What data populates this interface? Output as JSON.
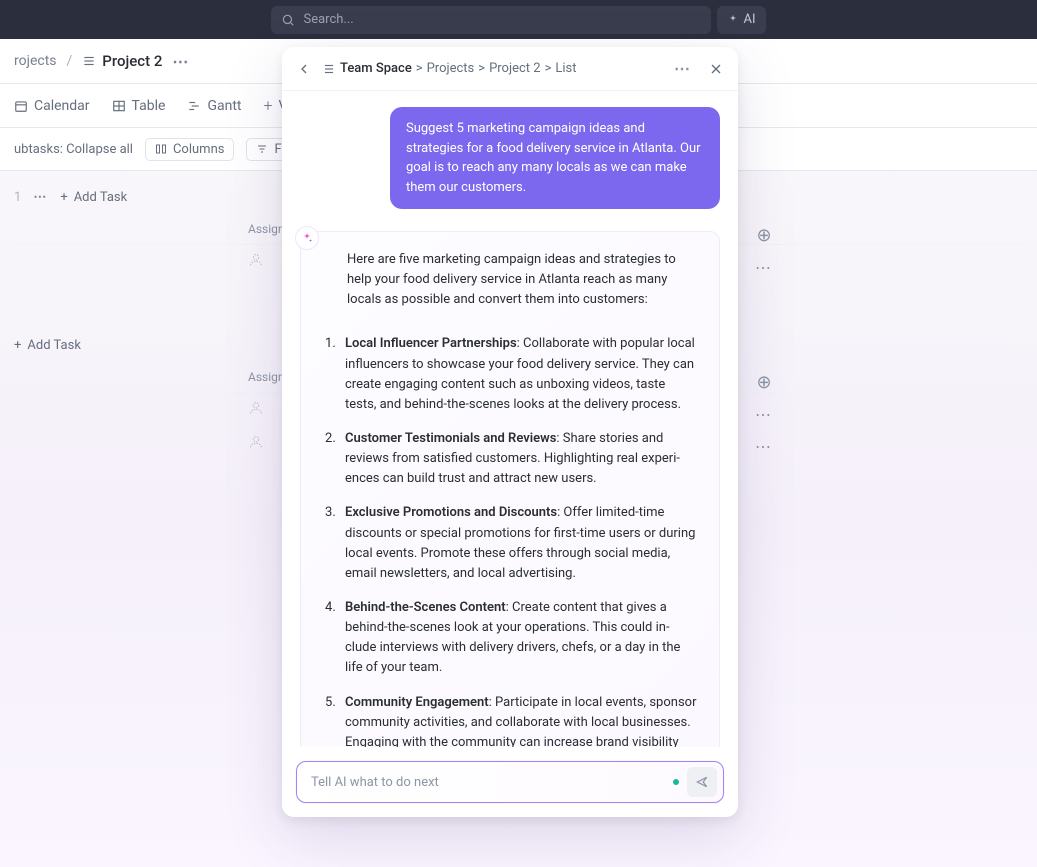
{
  "topbar": {
    "search_placeholder": "Search...",
    "ai_button": "AI"
  },
  "breadcrumb": {
    "parent": "rojects",
    "current": "Project 2"
  },
  "views": {
    "calendar": "Calendar",
    "table": "Table",
    "gantt": "Gantt",
    "add": "V"
  },
  "toolbar": {
    "subtasks": "ubtasks: Collapse all",
    "columns": "Columns",
    "filters": "Filters"
  },
  "tasks": {
    "num1": "1",
    "add_task": "Add Task",
    "assignee_header": "Assigne"
  },
  "ai_panel": {
    "breadcrumb": {
      "team_space": "Team Space",
      "projects": "Projects",
      "project2": "Project 2",
      "list": "List"
    },
    "user_message": "Suggest 5 marketing campaign ideas and strategies for a food delivery service in Atlanta. Our goal is to reach any many locals as we can make them our customers.",
    "ai_intro": "Here are five marketing campaign ideas and strategies to help your food delivery service in Atlanta reach as many locals as possible and convert them into customers:",
    "items": [
      {
        "title": "Local Influencer Partnerships",
        "body": ": Collaborate with popular local influencers to showcase your food delivery service. They can create engaging content such as unboxing videos, taste tests, and behind-the-scenes looks at the de­livery process."
      },
      {
        "title": "Customer Testimonials and Reviews",
        "body": ": Share stories and reviews from satisfied customers. Highlighting real experi­ences can build trust and attract new users."
      },
      {
        "title": "Exclusive Promotions and Discounts",
        "body": ": Offer limited-time discounts or special promotions for first-time users or during local events. Promote these offers through social media, email newsletters, and local advertising."
      },
      {
        "title": "Behind-the-Scenes Content",
        "body": ": Create content that gives a behind-the-scenes look at your operations. This could in­clude interviews with delivery drivers, chefs, or a day in the life of your team."
      },
      {
        "title": "Community Engagement",
        "body": ": Participate in local events, sponsor community activities, and collaborate with local businesses. Engaging with the community can increase brand visibility and foster a loyal customer base."
      }
    ],
    "input_placeholder": "Tell AI what to do next"
  }
}
